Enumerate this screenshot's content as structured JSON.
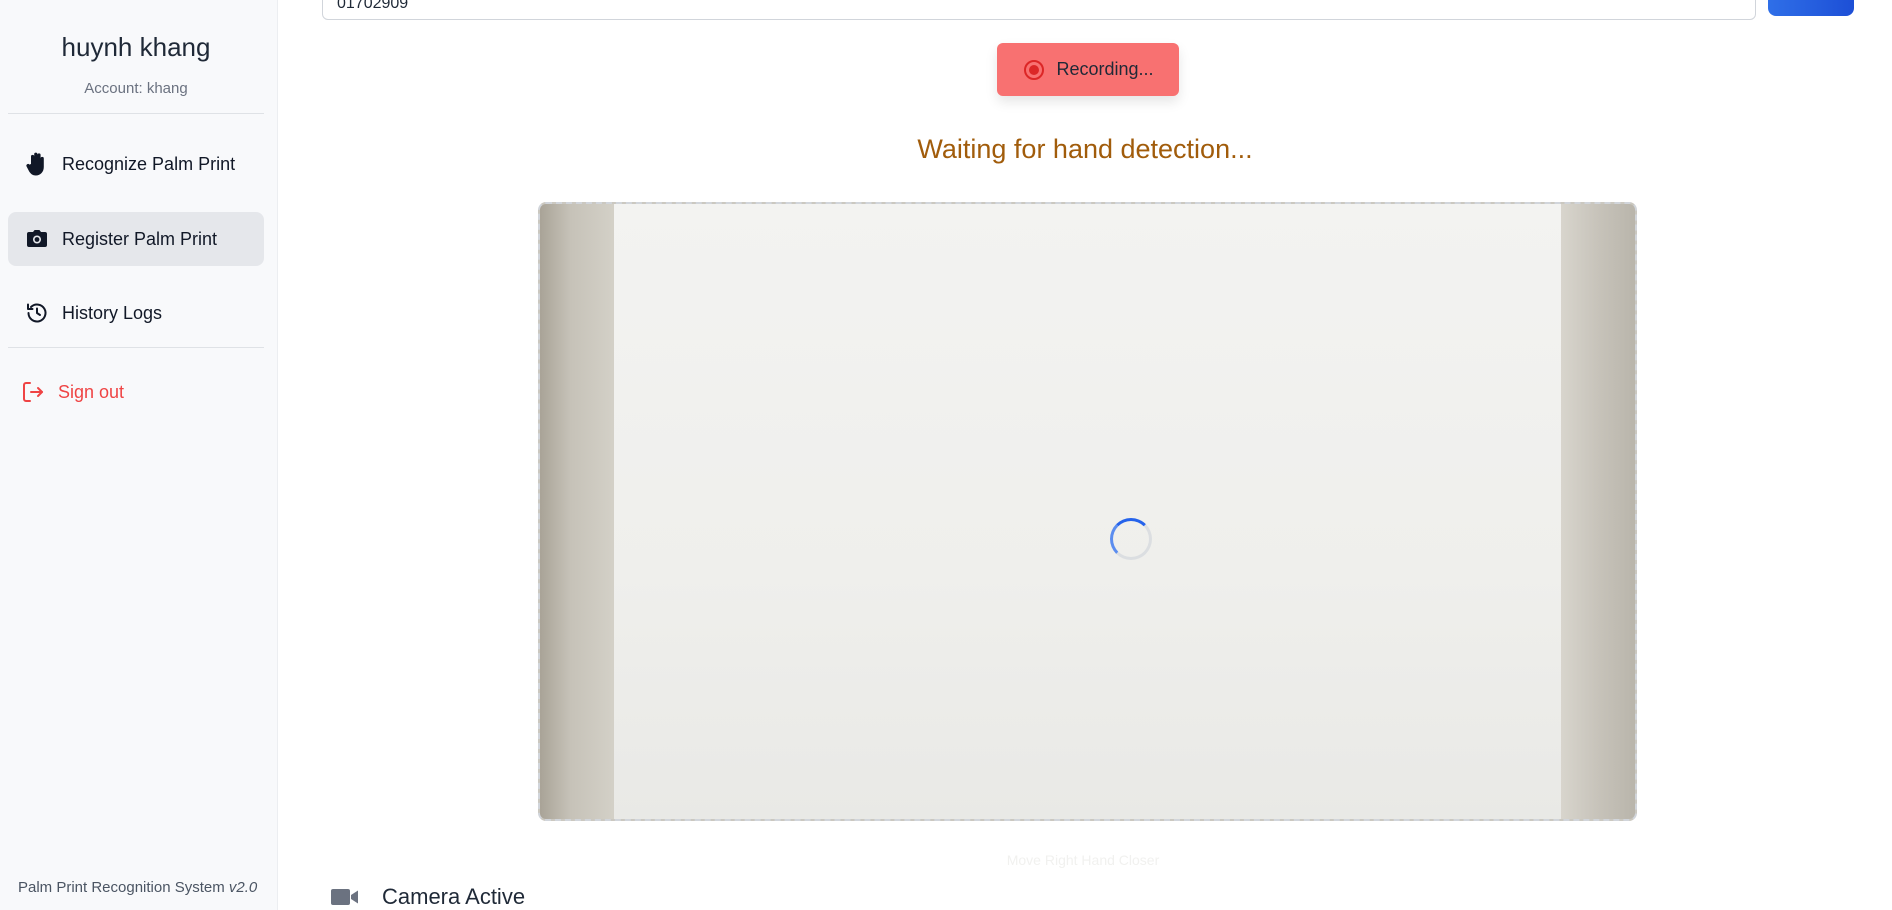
{
  "sidebar": {
    "user_name": "huynh khang",
    "account": "Account: khang",
    "items": [
      {
        "label": "Recognize Palm Print",
        "icon": "hand-icon"
      },
      {
        "label": "Register Palm Print",
        "icon": "camera-icon",
        "active": true
      },
      {
        "label": "History Logs",
        "icon": "history-icon"
      }
    ],
    "signout": {
      "label": "Sign out",
      "icon": "logout-icon"
    },
    "footer": {
      "name": "Palm Print Recognition System",
      "version": "v2.0"
    }
  },
  "main": {
    "top_input_value": "01702909",
    "recording_label": "Recording...",
    "status_text": "Waiting for hand detection...",
    "camera_hint": "Move Right Hand Closer",
    "camera_status": "Camera Active"
  },
  "colors": {
    "accent": "#2563eb",
    "recording_bg": "#f87171",
    "status_text": "#a15c0b",
    "signout": "#ef4444"
  }
}
